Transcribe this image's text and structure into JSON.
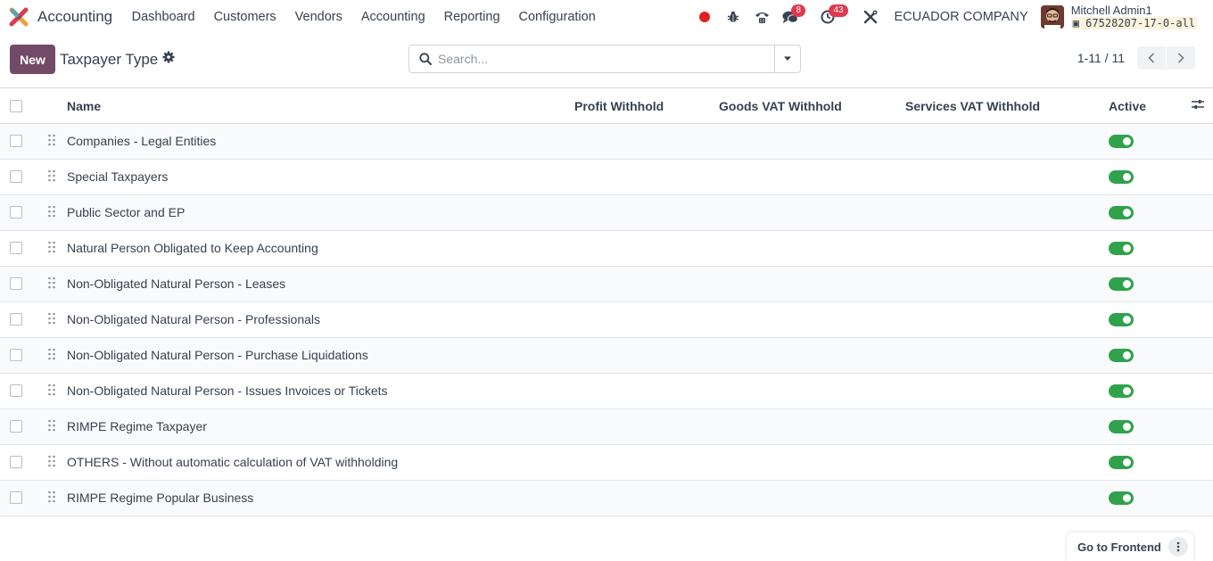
{
  "navbar": {
    "app_name": "Accounting",
    "menu": [
      "Dashboard",
      "Customers",
      "Vendors",
      "Accounting",
      "Reporting",
      "Configuration"
    ],
    "messages_badge": "8",
    "activities_badge": "43",
    "company": "ECUADOR COMPANY",
    "user_name": "Mitchell Admin1",
    "db_name": "67528207-17-0-all",
    "icons": [
      "record-icon",
      "bug-icon",
      "phone-icon",
      "chat-icon",
      "clock-icon",
      "tools-icon"
    ]
  },
  "control_panel": {
    "new_label": "New",
    "title": "Taxpayer Type",
    "search_placeholder": "Search...",
    "pager_value": "1-11 / 11"
  },
  "table": {
    "columns": [
      "Name",
      "Profit Withhold",
      "Goods VAT Withhold",
      "Services VAT Withhold",
      "Active"
    ],
    "rows": [
      {
        "name": "Companies - Legal Entities",
        "active": true
      },
      {
        "name": "Special Taxpayers",
        "active": true
      },
      {
        "name": "Public Sector and EP",
        "active": true
      },
      {
        "name": "Natural Person Obligated to Keep Accounting",
        "active": true
      },
      {
        "name": "Non-Obligated Natural Person - Leases",
        "active": true
      },
      {
        "name": "Non-Obligated Natural Person - Professionals",
        "active": true
      },
      {
        "name": "Non-Obligated Natural Person - Purchase Liquidations",
        "active": true
      },
      {
        "name": "Non-Obligated Natural Person - Issues Invoices or Tickets",
        "active": true
      },
      {
        "name": "RIMPE Regime Taxpayer",
        "active": true
      },
      {
        "name": "OTHERS - Without automatic calculation of VAT withholding",
        "active": true
      },
      {
        "name": "RIMPE Regime Popular Business",
        "active": true
      }
    ]
  },
  "footer": {
    "go_frontend_label": "Go to Frontend"
  },
  "colors": {
    "brand": "#714b67",
    "toggle_on": "#2fa24b",
    "badge": "#e0394f"
  }
}
